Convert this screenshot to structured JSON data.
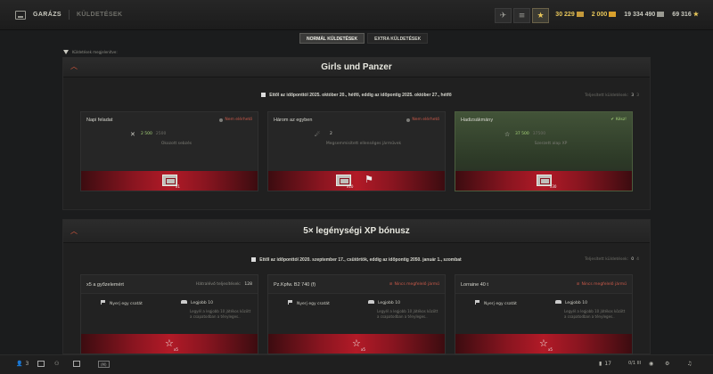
{
  "nav": {
    "garage": "GARÁZS",
    "missions": "KÜLDETÉSEK"
  },
  "currencies": {
    "gold_label": "30 229",
    "free_xp": "2 000",
    "credits": "19 334 490",
    "bonds": "69 316"
  },
  "colors": {
    "accent": "#e05b3e",
    "gold": "#e7c65a",
    "green": "#a8d57a",
    "red_bar": "#b21a27"
  },
  "tabs": [
    {
      "label": "NORMÁL KÜLDETÉSEK",
      "active": true
    },
    {
      "label": "EXTRA KÜLDETÉSEK",
      "active": false
    }
  ],
  "filter": {
    "label": "Küldetések megjelenítve:"
  },
  "panels": [
    {
      "title": "Girls und Panzer",
      "dates": "Ettől az időponttól 2025. október 20., hétfő, eddig az időpontig 2025. október 27., hétfő",
      "completed_label": "Teljesített küldetések:",
      "completed": "3",
      "total": "3",
      "cards": [
        {
          "title": "Napi feladat",
          "status": "Nem elérhető",
          "value": "2 500",
          "max": "2500",
          "desc": "Okozott sebzés",
          "reward_count": "x1"
        },
        {
          "title": "Három az egyben",
          "status": "Nem elérhető",
          "value": "2",
          "desc": "Megsemmisített ellenséges járművek",
          "reward_count": "x10"
        },
        {
          "title": "Hadizsákmány",
          "status": "Kész!",
          "value": "37 500",
          "max": "37500",
          "desc": "Szerzett alap XP",
          "reward_count": "x30"
        }
      ]
    },
    {
      "title": "5× legénységi XP bónusz",
      "dates": "Ettől az időponttól 2020. szeptember 17., csütörtök, eddig az időpontig 2050. január 1., szombat",
      "completed_label": "Teljesített küldetések:",
      "completed": "0",
      "total": "4",
      "cards": [
        {
          "title": "x5 a győzelemért",
          "status": "Hátralévő teljesítések:",
          "status_count": "128",
          "win": "Nyerj egy csatát",
          "best": "Legjobb 10",
          "best_desc": "Legyél a legjobb 10 játékos között a csapatodban a tényleges..",
          "reward_count": "x5"
        },
        {
          "title": "Pz.Kpfw. B2 740 (f)",
          "status": "Nincs megfelelő jármű",
          "win": "Nyerj egy csatát",
          "best": "Legjobb 10",
          "best_desc": "Legyél a legjobb 10 játékos között a csapatodban a tényleges..",
          "reward_count": "x5"
        },
        {
          "title": "Lorraine 40 t",
          "status": "Nincs megfelelő jármű",
          "win": "Nyerj egy csatát",
          "best": "Legjobb 10",
          "best_desc": "Legyél a legjobb 10 játékos között a csapatodban a tényleges..",
          "reward_count": "x5"
        }
      ]
    }
  ],
  "bottom": {
    "friends_count": "3",
    "ms_label": "(M)",
    "stats_count": "17",
    "ping": "0/1 III"
  }
}
